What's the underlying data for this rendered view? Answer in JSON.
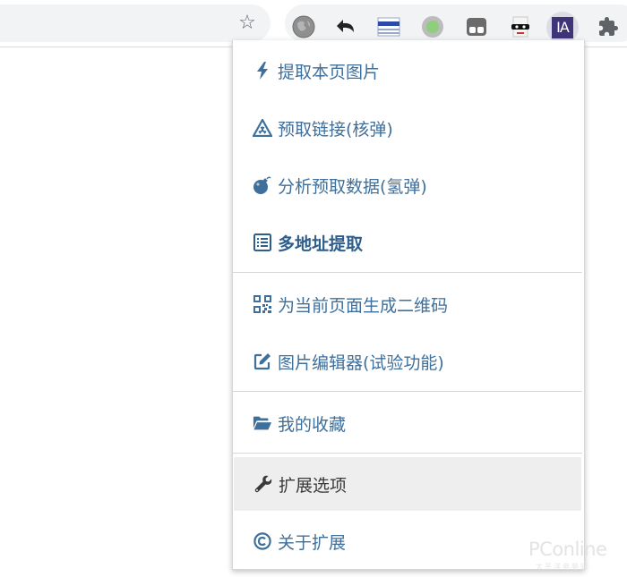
{
  "browser": {
    "star_glyph": "☆",
    "extensions": [
      {
        "name": "globe-extension-icon"
      },
      {
        "name": "back-arrow-extension-icon"
      },
      {
        "name": "flag-extension-icon"
      },
      {
        "name": "green-dot-extension-icon"
      },
      {
        "name": "tab-extension-icon"
      },
      {
        "name": "mask-extension-icon"
      },
      {
        "name": "ia-extension-icon",
        "label": "IA",
        "active": true
      },
      {
        "name": "puzzle-icon"
      }
    ]
  },
  "menu": {
    "items": [
      {
        "label": "提取本页图片",
        "icon": "lightning-icon"
      },
      {
        "label": "预取链接(核弹)",
        "icon": "radiation-warning-icon"
      },
      {
        "label": "分析预取数据(氢弹)",
        "icon": "bomb-icon"
      },
      {
        "label": "多地址提取",
        "icon": "list-icon",
        "bold": true
      },
      {
        "label": "为当前页面生成二维码",
        "icon": "qrcode-icon"
      },
      {
        "label": "图片编辑器(试验功能)",
        "icon": "edit-icon"
      },
      {
        "label": "我的收藏",
        "icon": "folder-open-icon"
      },
      {
        "label": "扩展选项",
        "icon": "wrench-icon",
        "hover": true
      },
      {
        "label": "关于扩展",
        "icon": "copyright-icon"
      }
    ]
  },
  "watermark": {
    "text": "PConline",
    "sub": "太平洋电脑网"
  },
  "colors": {
    "accent": "#3f6f9b",
    "toolbar_bg": "#f1f3f4",
    "hover_bg": "#eeeeee"
  }
}
